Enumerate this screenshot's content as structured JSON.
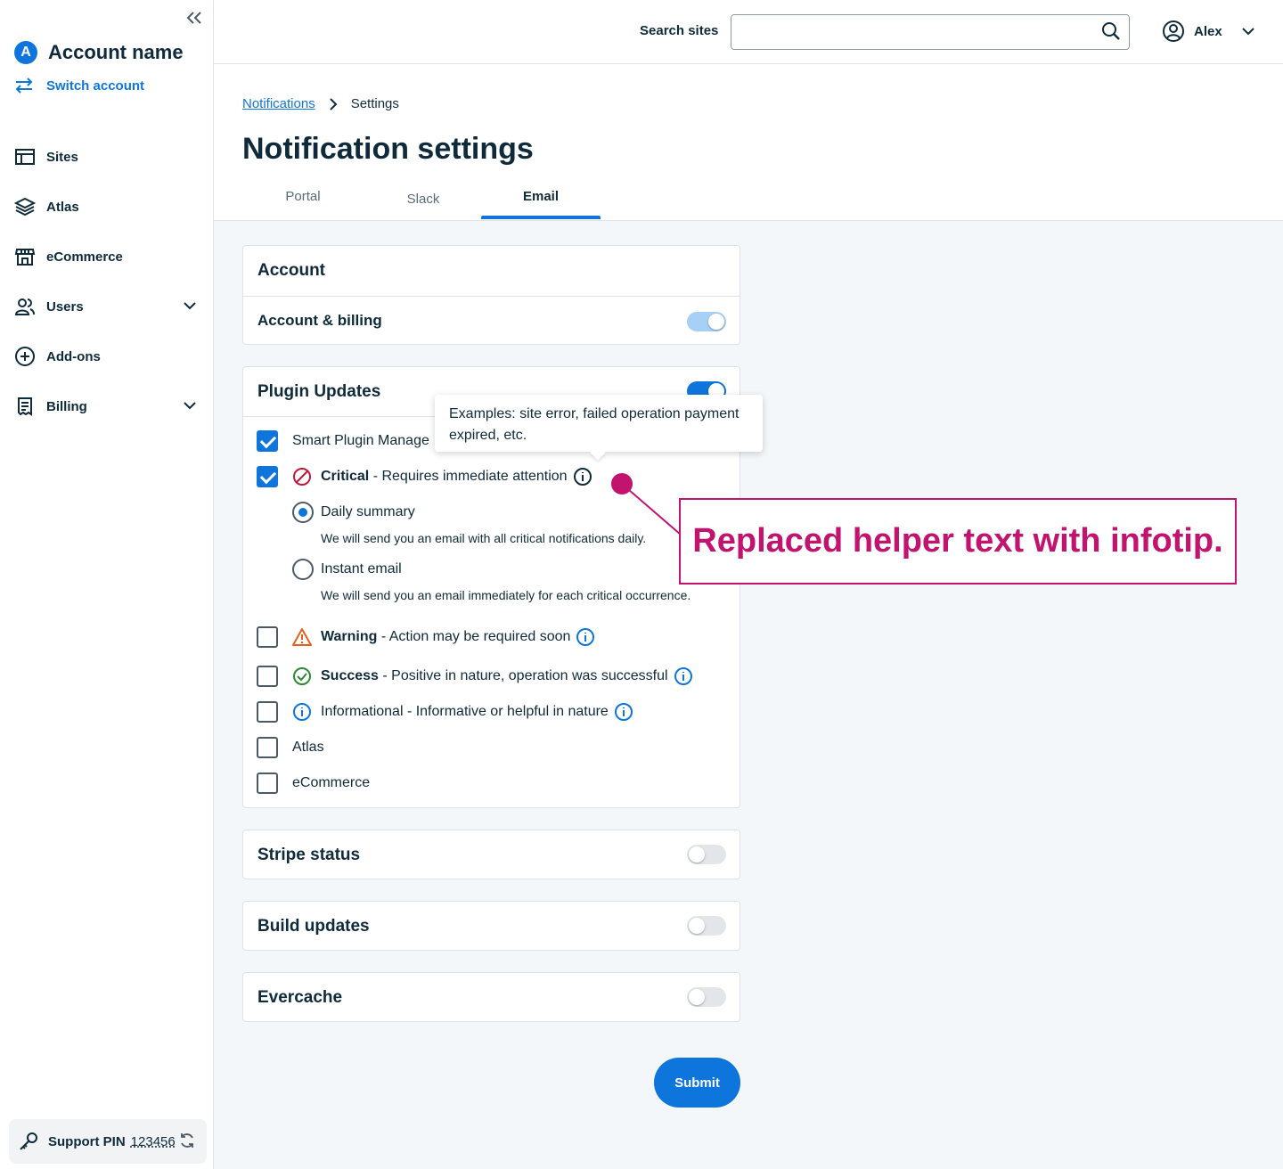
{
  "colors": {
    "accent": "#0e75dc",
    "annotation": "#c2136f",
    "critical": "#c4163b",
    "warning": "#e2621b",
    "success": "#2d8a34",
    "info": "#0e75dc"
  },
  "sidebar": {
    "collapse_icon": "double-chevron-left-icon",
    "account_initial": "A",
    "account_name": "Account name",
    "switch_account": "Switch account",
    "items": [
      {
        "label": "Sites",
        "icon": "browser-icon"
      },
      {
        "label": "Atlas",
        "icon": "layers-icon"
      },
      {
        "label": "eCommerce",
        "icon": "store-icon"
      },
      {
        "label": "Users",
        "icon": "users-icon",
        "expandable": true
      },
      {
        "label": "Add-ons",
        "icon": "plus-circle-icon"
      },
      {
        "label": "Billing",
        "icon": "receipt-icon",
        "expandable": true
      }
    ],
    "support_pin_label": "Support PIN",
    "support_pin_value": "123456"
  },
  "topbar": {
    "search_label": "Search sites",
    "search_value": "",
    "search_placeholder": "",
    "user_name": "Alex"
  },
  "header": {
    "breadcrumb": {
      "parent": "Notifications",
      "current": "Settings"
    },
    "title": "Notification settings",
    "tabs": [
      {
        "label": "Portal",
        "active": false
      },
      {
        "label": "Slack",
        "active": false
      },
      {
        "label": "Email",
        "active": true
      }
    ]
  },
  "cards": {
    "account": {
      "title": "Account",
      "row_label": "Account & billing",
      "row_toggle": "on-disabled"
    },
    "plugin": {
      "title": "Plugin Updates",
      "toggle": "on",
      "smart_plugin": "Smart Plugin Manage",
      "critical_bold": "Critical",
      "critical_text": " - Requires immediate attention",
      "daily_summary": "Daily summary",
      "daily_helper": "We will send you an email with all critical notifications daily.",
      "instant_email": "Instant email",
      "instant_helper": "We will send you an email immediately for each critical occurrence.",
      "warning_bold": "Warning",
      "warning_text": " - Action may be required soon",
      "success_bold": "Success",
      "success_text": " - Positive in nature, operation was successful",
      "informational_text": "Informational - Informative or helpful in nature",
      "atlas": "Atlas",
      "ecommerce": "eCommerce",
      "tooltip": "Examples: site error, failed operation payment expired, etc."
    },
    "stripe": {
      "title": "Stripe status",
      "toggle": "off"
    },
    "build": {
      "title": "Build updates",
      "toggle": "off"
    },
    "evercache": {
      "title": "Evercache",
      "toggle": "off"
    }
  },
  "submit_label": "Submit",
  "annotation": "Replaced helper text with infotip."
}
